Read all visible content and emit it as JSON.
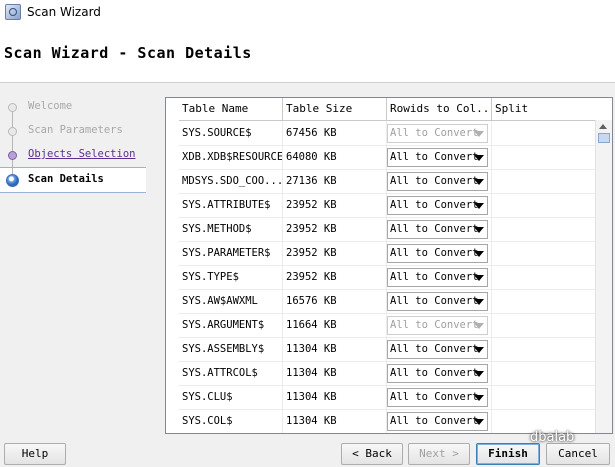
{
  "window": {
    "title": "Scan Wizard",
    "icon": "scan-wizard-icon"
  },
  "header": {
    "page_title": "Scan Wizard - Scan Details"
  },
  "steps": [
    {
      "label": "Welcome",
      "state": "disabled"
    },
    {
      "label": "Scan Parameters",
      "state": "disabled"
    },
    {
      "label": "Objects Selection",
      "state": "visited"
    },
    {
      "label": "Scan Details",
      "state": "current"
    }
  ],
  "table": {
    "columns": [
      "Table Name",
      "Table Size",
      "Rowids to Col...",
      "Split"
    ],
    "rows": [
      {
        "name": "SYS.SOURCE$",
        "size": "67456 KB",
        "rowids": "All to Convert",
        "enabled": false
      },
      {
        "name": "XDB.XDB$RESOURCE",
        "size": "64080 KB",
        "rowids": "All to Convert",
        "enabled": true
      },
      {
        "name": "MDSYS.SDO_COO...",
        "size": "27136 KB",
        "rowids": "All to Convert",
        "enabled": true
      },
      {
        "name": "SYS.ATTRIBUTE$",
        "size": "23952 KB",
        "rowids": "All to Convert",
        "enabled": true
      },
      {
        "name": "SYS.METHOD$",
        "size": "23952 KB",
        "rowids": "All to Convert",
        "enabled": true
      },
      {
        "name": "SYS.PARAMETER$",
        "size": "23952 KB",
        "rowids": "All to Convert",
        "enabled": true
      },
      {
        "name": "SYS.TYPE$",
        "size": "23952 KB",
        "rowids": "All to Convert",
        "enabled": true
      },
      {
        "name": "SYS.AW$AWXML",
        "size": "16576 KB",
        "rowids": "All to Convert",
        "enabled": true
      },
      {
        "name": "SYS.ARGUMENT$",
        "size": "11664 KB",
        "rowids": "All to Convert",
        "enabled": false
      },
      {
        "name": "SYS.ASSEMBLY$",
        "size": "11304 KB",
        "rowids": "All to Convert",
        "enabled": true
      },
      {
        "name": "SYS.ATTRCOL$",
        "size": "11304 KB",
        "rowids": "All to Convert",
        "enabled": true
      },
      {
        "name": "SYS.CLU$",
        "size": "11304 KB",
        "rowids": "All to Convert",
        "enabled": true
      },
      {
        "name": "SYS.COL$",
        "size": "11304 KB",
        "rowids": "All to Convert",
        "enabled": true
      }
    ]
  },
  "footer": {
    "help": "Help",
    "back": "< Back",
    "next": "Next >",
    "finish": "Finish",
    "cancel": "Cancel"
  },
  "watermark": "dbalab"
}
